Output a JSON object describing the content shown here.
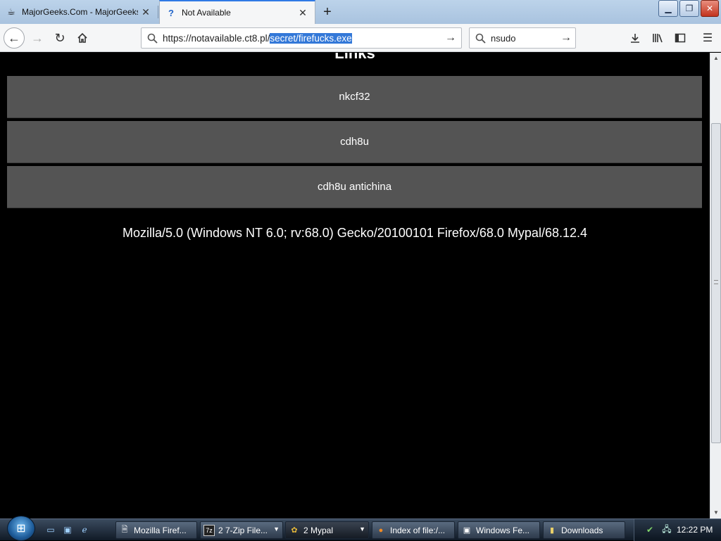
{
  "browser": {
    "tabs": [
      {
        "title": "MajorGeeks.Com - MajorGeeks",
        "icon": "majorgeeks-icon"
      },
      {
        "title": "Not Available",
        "icon": "question-icon",
        "active": true
      }
    ],
    "url_prefix": "https://notavailable.ct8.pl/",
    "url_selected": "secret/firefucks.exe",
    "search_value": "nsudo"
  },
  "page": {
    "heading": "Links",
    "links": [
      "nkcf32",
      "cdh8u",
      "cdh8u antichina"
    ],
    "user_agent": "Mozilla/5.0 (Windows NT 6.0; rv:68.0) Gecko/20100101 Firefox/68.0 Mypal/68.12.4"
  },
  "taskbar": {
    "tasks": [
      {
        "label": "Mozilla Firef...",
        "icon": "firefox-doc-icon"
      },
      {
        "label": "2 7-Zip File...",
        "icon": "7zip-icon",
        "dropdown": true
      },
      {
        "label": "2 Mypal",
        "icon": "mypal-icon",
        "dropdown": true,
        "active": true
      },
      {
        "label": "Index of file:/...",
        "icon": "firefox-icon"
      },
      {
        "label": "Windows Fe...",
        "icon": "window-icon"
      },
      {
        "label": "Downloads",
        "icon": "folder-icon"
      }
    ],
    "clock": "12:22 PM"
  }
}
